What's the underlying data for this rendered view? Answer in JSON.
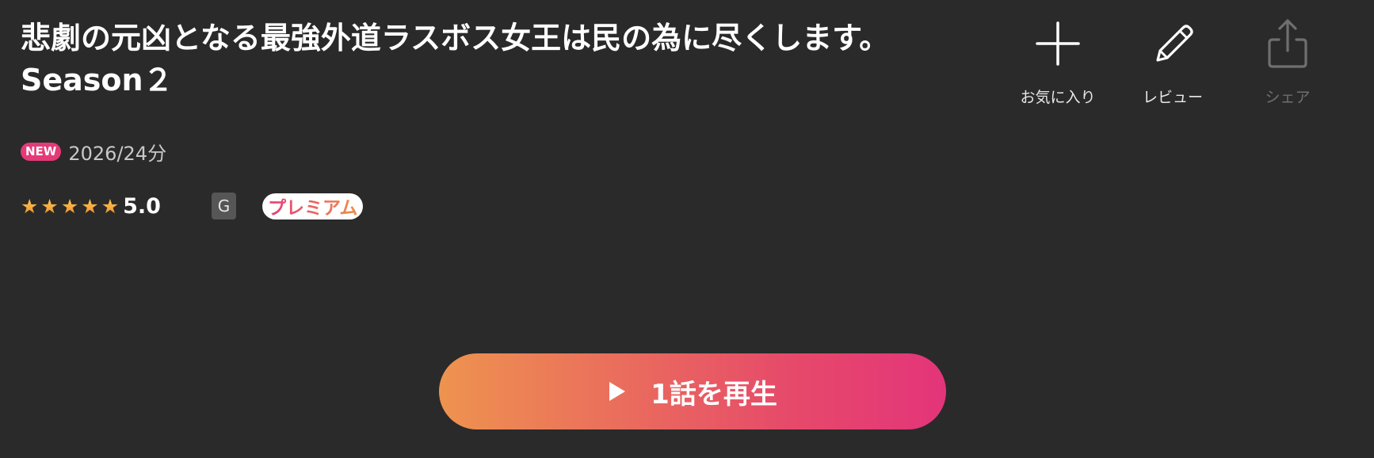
{
  "title": "悲劇の元凶となる最強外道ラスボス女王は民の為に尽くします。Season２",
  "meta": {
    "new_badge": "NEW",
    "year_duration": "2026/24分"
  },
  "rating": {
    "stars_filled": 5,
    "stars_total": 5,
    "score": "5.0",
    "age_rating": "G",
    "plan_badge": "プレミアム"
  },
  "actions": {
    "favorite": {
      "label": "お気に入り",
      "icon": "plus-icon"
    },
    "review": {
      "label": "レビュー",
      "icon": "pencil-icon"
    },
    "share": {
      "label": "シェア",
      "icon": "share-icon",
      "disabled": true
    }
  },
  "play": {
    "label": "1話を再生",
    "icon": "play-icon"
  },
  "colors": {
    "background": "#2a2a2a",
    "accent_pink": "#e3347a",
    "accent_orange": "#ee934f",
    "star": "#f5a93a"
  }
}
